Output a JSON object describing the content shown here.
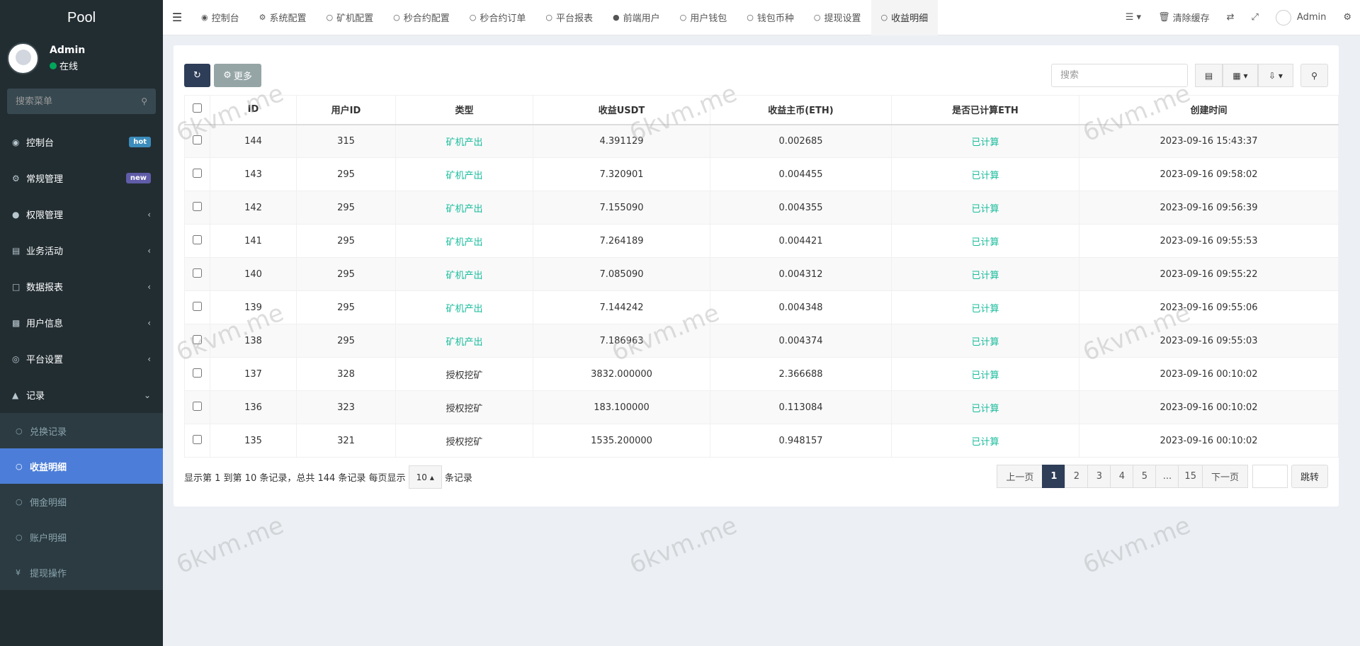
{
  "sidebar": {
    "logo": "Pool",
    "user": {
      "name": "Admin",
      "status": "在线"
    },
    "search_placeholder": "搜索菜单",
    "items": [
      {
        "label": "控制台",
        "badge": "hot"
      },
      {
        "label": "常规管理",
        "badge": "new"
      },
      {
        "label": "权限管理"
      },
      {
        "label": "业务活动"
      },
      {
        "label": "数据报表"
      },
      {
        "label": "用户信息"
      },
      {
        "label": "平台设置"
      },
      {
        "label": "记录"
      }
    ],
    "subitems": [
      {
        "label": "兑换记录"
      },
      {
        "label": "收益明细"
      },
      {
        "label": "佣金明细"
      },
      {
        "label": "账户明细"
      },
      {
        "label": "提现操作"
      }
    ]
  },
  "topnav": {
    "tabs": [
      "控制台",
      "系统配置",
      "矿机配置",
      "秒合约配置",
      "秒合约订单",
      "平台报表",
      "前端用户",
      "用户钱包",
      "钱包币种",
      "提现设置",
      "收益明细"
    ],
    "clear_cache": "清除缓存",
    "admin": "Admin"
  },
  "toolbar": {
    "more_label": "更多",
    "search_placeholder": "搜索"
  },
  "table": {
    "headers": [
      "ID",
      "用户ID",
      "类型",
      "收益USDT",
      "收益主币(ETH)",
      "是否已计算ETH",
      "创建时间"
    ],
    "rows": [
      [
        "144",
        "315",
        "矿机产出",
        "4.391129",
        "0.002685",
        "已计算",
        "2023-09-16 15:43:37"
      ],
      [
        "143",
        "295",
        "矿机产出",
        "7.320901",
        "0.004455",
        "已计算",
        "2023-09-16 09:58:02"
      ],
      [
        "142",
        "295",
        "矿机产出",
        "7.155090",
        "0.004355",
        "已计算",
        "2023-09-16 09:56:39"
      ],
      [
        "141",
        "295",
        "矿机产出",
        "7.264189",
        "0.004421",
        "已计算",
        "2023-09-16 09:55:53"
      ],
      [
        "140",
        "295",
        "矿机产出",
        "7.085090",
        "0.004312",
        "已计算",
        "2023-09-16 09:55:22"
      ],
      [
        "139",
        "295",
        "矿机产出",
        "7.144242",
        "0.004348",
        "已计算",
        "2023-09-16 09:55:06"
      ],
      [
        "138",
        "295",
        "矿机产出",
        "7.186963",
        "0.004374",
        "已计算",
        "2023-09-16 09:55:03"
      ],
      [
        "137",
        "328",
        "授权挖矿",
        "3832.000000",
        "2.366688",
        "已计算",
        "2023-09-16 00:10:02"
      ],
      [
        "136",
        "323",
        "授权挖矿",
        "183.100000",
        "0.113084",
        "已计算",
        "2023-09-16 00:10:02"
      ],
      [
        "135",
        "321",
        "授权挖矿",
        "1535.200000",
        "0.948157",
        "已计算",
        "2023-09-16 00:10:02"
      ]
    ]
  },
  "footer": {
    "info_prefix": "显示第 1 到第 10 条记录，总共 144 条记录 每页显示",
    "page_size": "10",
    "info_suffix": "条记录",
    "prev": "上一页",
    "pages": [
      "1",
      "2",
      "3",
      "4",
      "5",
      "...",
      "15"
    ],
    "next": "下一页",
    "jump": "跳转"
  },
  "watermark": "6kvm.me",
  "colors": {
    "sidebar_bg": "#222d32",
    "active_blue": "#4c7ed9",
    "dark_btn": "#2e3d58",
    "green": "#18bc9c"
  }
}
